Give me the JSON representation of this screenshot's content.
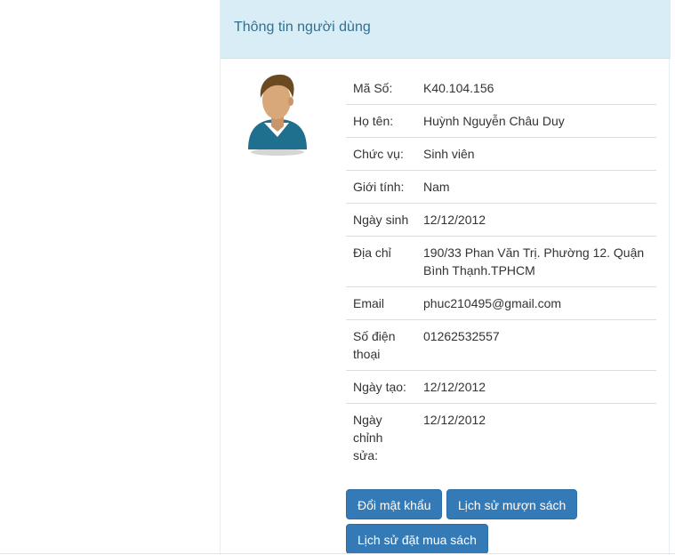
{
  "panel": {
    "title": "Thông tin người dùng"
  },
  "avatar": {
    "icon": "user-avatar-icon",
    "colors": {
      "hair": "#6b4a22",
      "skin": "#d9a878",
      "shirt": "#1f6f8f",
      "collar": "#ffffff"
    }
  },
  "profile": {
    "rows": [
      {
        "label": "Mã Số:",
        "value": "K40.104.156"
      },
      {
        "label": "Họ tên:",
        "value": "Huỳnh Nguyễn Châu Duy"
      },
      {
        "label": "Chức vụ:",
        "value": "Sinh viên"
      },
      {
        "label": "Giới tính:",
        "value": "Nam"
      },
      {
        "label": "Ngày sinh",
        "value": "12/12/2012"
      },
      {
        "label": "Địa chỉ",
        "value": "190/33 Phan Văn Trị. Phường 12. Quận Bình Thạnh.TPHCM"
      },
      {
        "label": "Email",
        "value": "phuc210495@gmail.com"
      },
      {
        "label": "Số điện thoại",
        "value": "01262532557"
      },
      {
        "label": "Ngày tạo:",
        "value": "12/12/2012"
      },
      {
        "label": "Ngày chỉnh sửa:",
        "value": "12/12/2012"
      }
    ]
  },
  "actions": {
    "change_password": "Đổi mật khẩu",
    "borrow_history": "Lịch sử mượn sách",
    "order_history": "Lịch sử đặt mua sách"
  },
  "colors": {
    "heading_bg": "#d9edf7",
    "heading_text": "#31708f",
    "button_bg": "#337ab7"
  }
}
